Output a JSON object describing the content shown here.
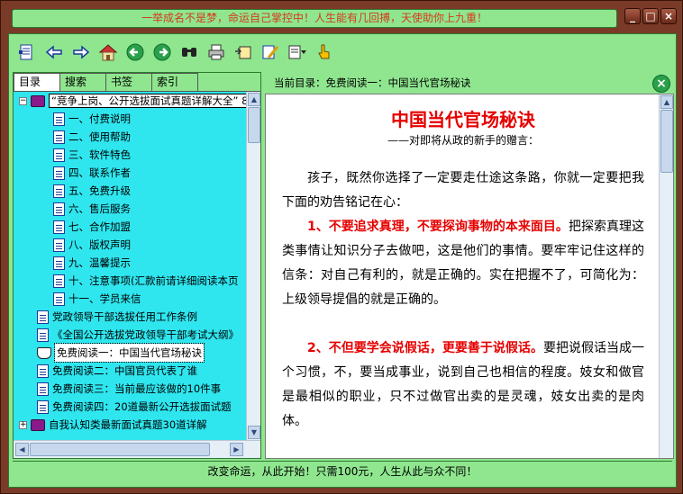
{
  "window": {
    "title": "一举成名不是梦，命运自己掌控中！人生能有几回搏，天使助你上九重！",
    "controls": [
      "minimize",
      "maximize",
      "close"
    ]
  },
  "toolbar": {
    "buttons": [
      "contents-icon",
      "back-arrow-icon",
      "forward-arrow-icon",
      "home-icon",
      "previous-circle-icon",
      "next-circle-icon",
      "find-icon",
      "print-icon",
      "bookmark-add-icon",
      "notes-icon",
      "options-icon",
      "pointer-hand-icon"
    ]
  },
  "left": {
    "tabs": [
      "目录",
      "搜索",
      "书签",
      "索引"
    ],
    "active_tab": "目录",
    "root": "“竞争上岗、公开选拔面试真题详解大全” 8.8.0版",
    "children": [
      "一、付费说明",
      "二、使用帮助",
      "三、软件特色",
      "四、联系作者",
      "五、免费升级",
      "六、售后服务",
      "七、合作加盟",
      "八、版权声明",
      "九、温馨提示",
      "十、注意事项(汇款前请详细阅读本页",
      "十一、学员来信"
    ],
    "items": [
      "党政领导干部选拔任用工作条例",
      "《全国公开选拔党政领导干部考试大纲》",
      "免费阅读一：中国当代官场秘诀",
      "免费阅读二：中国官员代表了谁",
      "免费阅读三：当前最应该做的10件事",
      "免费阅读四：20道最新公开选拔面试题",
      "自我认知类最新面试真题30道详解"
    ],
    "selected": "免费阅读一：中国当代官场秘诀"
  },
  "right": {
    "current_dir": "当前目录：免费阅读一：中国当代官场秘诀",
    "article": {
      "title": "中国当代官场秘诀",
      "subtitle": "——对即将从政的新手的赠言：",
      "p1": "孩子，既然你选择了一定要走仕途这条路，你就一定要把我下面的劝告铭记在心：",
      "p2_red": "1、不要追求真理，不要探询事物的本来面目。",
      "p2_rest": "把探索真理这类事情让知识分子去做吧，这是他们的事情。要牢牢记住这样的信条：对自己有利的，就是正确的。实在把握不了，可简化为：上级领导提倡的就是正确的。",
      "p3_red": "2、不但要学会说假话，更要善于说假话。",
      "p3_rest": "要把说假话当成一个习惯，不，要当成事业，说到自己也相信的程度。妓女和做官是最相似的职业，只不过做官出卖的是灵魂，妓女出卖的是肉体。"
    }
  },
  "status": "改变命运，从此开始！只需100元，人生从此与众不同！",
  "colors": {
    "frame": "#7a3a28",
    "panel": "#8fe68f",
    "tree_bg": "#2fe6ef",
    "title_text": "#d63a1a",
    "article_red": "#e60000"
  }
}
